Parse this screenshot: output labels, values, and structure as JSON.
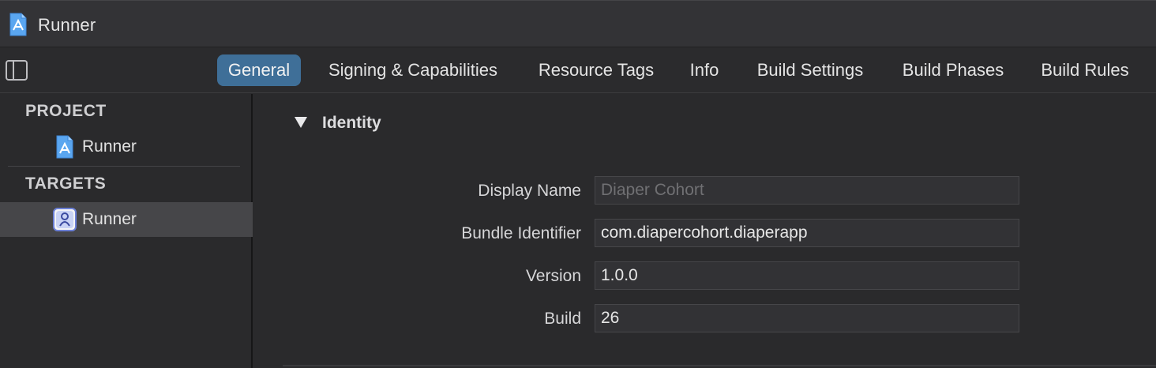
{
  "window": {
    "title": "Runner"
  },
  "tabs": [
    {
      "label": "General",
      "active": true
    },
    {
      "label": "Signing & Capabilities",
      "active": false
    },
    {
      "label": "Resource Tags",
      "active": false
    },
    {
      "label": "Info",
      "active": false
    },
    {
      "label": "Build Settings",
      "active": false
    },
    {
      "label": "Build Phases",
      "active": false
    },
    {
      "label": "Build Rules",
      "active": false
    }
  ],
  "sidebar": {
    "project_header": "PROJECT",
    "project_items": [
      {
        "label": "Runner",
        "icon": "xcode-project-icon"
      }
    ],
    "targets_header": "TARGETS",
    "target_items": [
      {
        "label": "Runner",
        "icon": "app-target-icon",
        "selected": true
      }
    ]
  },
  "identity": {
    "section_title": "Identity",
    "display_name": {
      "label": "Display Name",
      "value": "",
      "placeholder": "Diaper Cohort"
    },
    "bundle_identifier": {
      "label": "Bundle Identifier",
      "value": "com.diapercohort.diaperapp"
    },
    "version": {
      "label": "Version",
      "value": "1.0.0"
    },
    "build": {
      "label": "Build",
      "value": "26"
    }
  },
  "colors": {
    "accent": "#3f6f98",
    "background": "#2a2a2c",
    "selection": "#464649"
  }
}
